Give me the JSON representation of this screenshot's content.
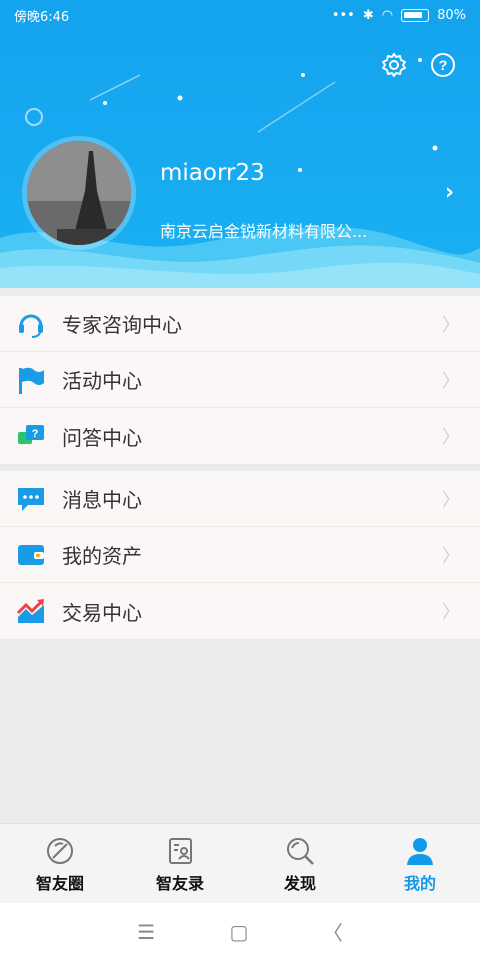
{
  "status": {
    "time": "傍晚6:46",
    "battery": "80%"
  },
  "profile": {
    "username": "miaorr23",
    "company": "南京云启金锐新材料有限公..."
  },
  "menu_group_1": [
    {
      "label": "专家咨询中心",
      "icon": "headset-icon"
    },
    {
      "label": "活动中心",
      "icon": "flag-icon"
    },
    {
      "label": "问答中心",
      "icon": "qa-chat-icon"
    }
  ],
  "menu_group_2": [
    {
      "label": "消息中心",
      "icon": "message-bubble-icon"
    },
    {
      "label": "我的资产",
      "icon": "wallet-icon"
    },
    {
      "label": "交易中心",
      "icon": "trend-chart-icon"
    }
  ],
  "tabs": [
    {
      "label": "智友圈",
      "icon": "circle-compass-icon",
      "active": false
    },
    {
      "label": "智友录",
      "icon": "contacts-book-icon",
      "active": false
    },
    {
      "label": "发现",
      "icon": "search-icon",
      "active": false
    },
    {
      "label": "我的",
      "icon": "person-icon",
      "active": true
    }
  ],
  "colors": {
    "accent": "#1199ea",
    "header": "#14a3ee"
  }
}
